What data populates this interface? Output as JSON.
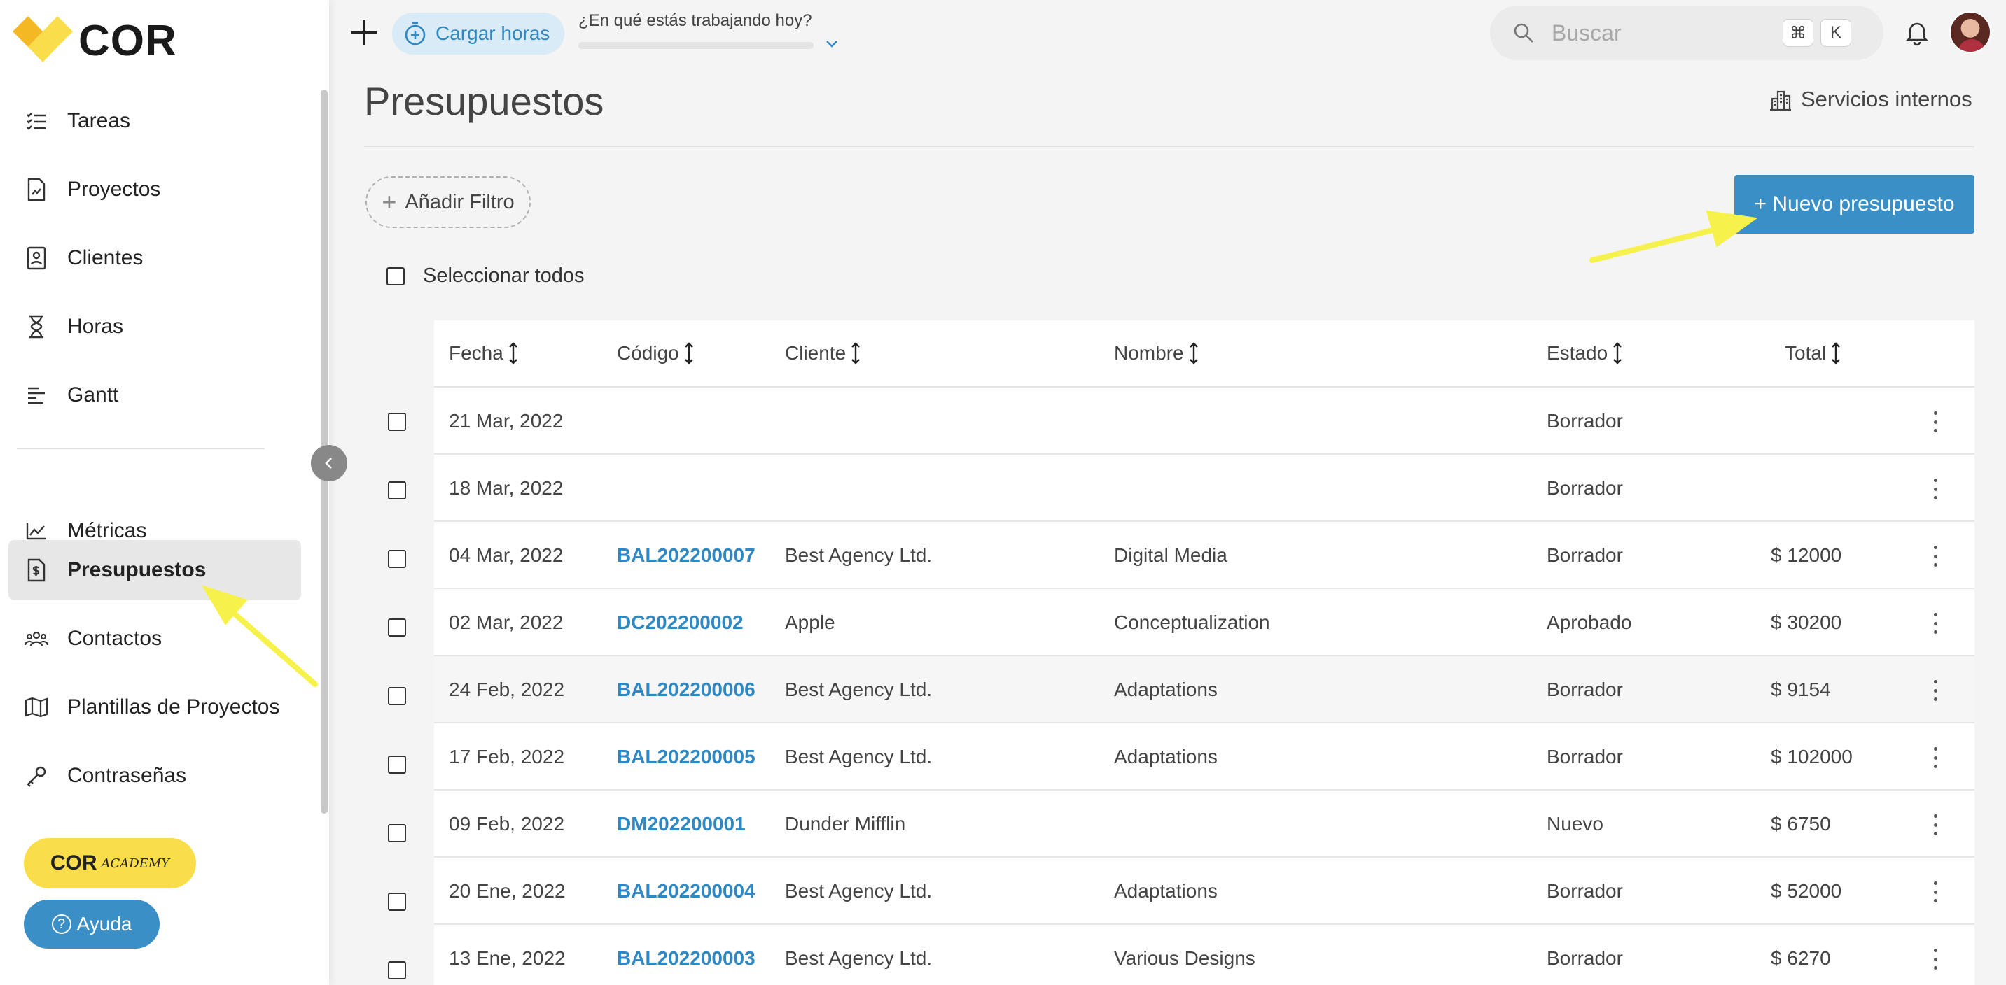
{
  "brand": {
    "name": "COR",
    "yellow": "#fadd4b",
    "blue": "#3a8fc7"
  },
  "sidebar": {
    "items": [
      {
        "label": "Tareas",
        "icon": "checklist-icon"
      },
      {
        "label": "Proyectos",
        "icon": "document-icon"
      },
      {
        "label": "Clientes",
        "icon": "contact-card-icon"
      },
      {
        "label": "Horas",
        "icon": "hourglass-icon"
      },
      {
        "label": "Gantt",
        "icon": "gantt-icon"
      },
      {
        "label": "Métricas",
        "icon": "chart-icon"
      },
      {
        "label": "Presupuestos",
        "icon": "budget-icon",
        "active": true
      },
      {
        "label": "Contactos",
        "icon": "people-icon"
      },
      {
        "label": "Plantillas de Proyectos",
        "icon": "map-icon"
      },
      {
        "label": "Contraseñas",
        "icon": "key-icon"
      }
    ],
    "academy_label": "COR",
    "academy_sub": "ACADEMY",
    "help_label": "Ayuda"
  },
  "topbar": {
    "cargar_label": "Cargar horas",
    "working_label": "¿En qué estás trabajando hoy?",
    "search_placeholder": "Buscar",
    "kbd_cmd": "⌘",
    "kbd_k": "K"
  },
  "header": {
    "title": "Presupuestos",
    "servicios_label": "Servicios internos",
    "filter_label": "Añadir Filtro",
    "new_label": "+ Nuevo presupuesto",
    "select_all_label": "Seleccionar todos"
  },
  "table": {
    "columns": [
      "Fecha",
      "Código",
      "Cliente",
      "Nombre",
      "Estado",
      "Total"
    ],
    "rows": [
      {
        "fecha": "21 Mar, 2022",
        "codigo": "",
        "cliente": "",
        "nombre": "",
        "estado": "Borrador",
        "total": ""
      },
      {
        "fecha": "18 Mar, 2022",
        "codigo": "",
        "cliente": "",
        "nombre": "",
        "estado": "Borrador",
        "total": ""
      },
      {
        "fecha": "04 Mar, 2022",
        "codigo": "BAL202200007",
        "cliente": "Best Agency Ltd.",
        "nombre": "Digital Media",
        "estado": "Borrador",
        "total": "$  12000"
      },
      {
        "fecha": "02 Mar, 2022",
        "codigo": "DC202200002",
        "cliente": "Apple",
        "nombre": "Conceptualization",
        "estado": "Aprobado",
        "total": "$  30200"
      },
      {
        "fecha": "24 Feb, 2022",
        "codigo": "BAL202200006",
        "cliente": "Best Agency Ltd.",
        "nombre": "Adaptations",
        "estado": "Borrador",
        "total": "$  9154"
      },
      {
        "fecha": "17 Feb, 2022",
        "codigo": "BAL202200005",
        "cliente": "Best Agency Ltd.",
        "nombre": "Adaptations",
        "estado": "Borrador",
        "total": "$  102000"
      },
      {
        "fecha": "09 Feb, 2022",
        "codigo": "DM202200001",
        "cliente": "Dunder Mifflin",
        "nombre": "",
        "estado": "Nuevo",
        "total": "$  6750"
      },
      {
        "fecha": "20 Ene, 2022",
        "codigo": "BAL202200004",
        "cliente": "Best Agency Ltd.",
        "nombre": "Adaptations",
        "estado": "Borrador",
        "total": "$  52000"
      },
      {
        "fecha": "13 Ene, 2022",
        "codigo": "BAL202200003",
        "cliente": "Best Agency Ltd.",
        "nombre": "Various Designs",
        "estado": "Borrador",
        "total": "$  6270"
      }
    ]
  }
}
